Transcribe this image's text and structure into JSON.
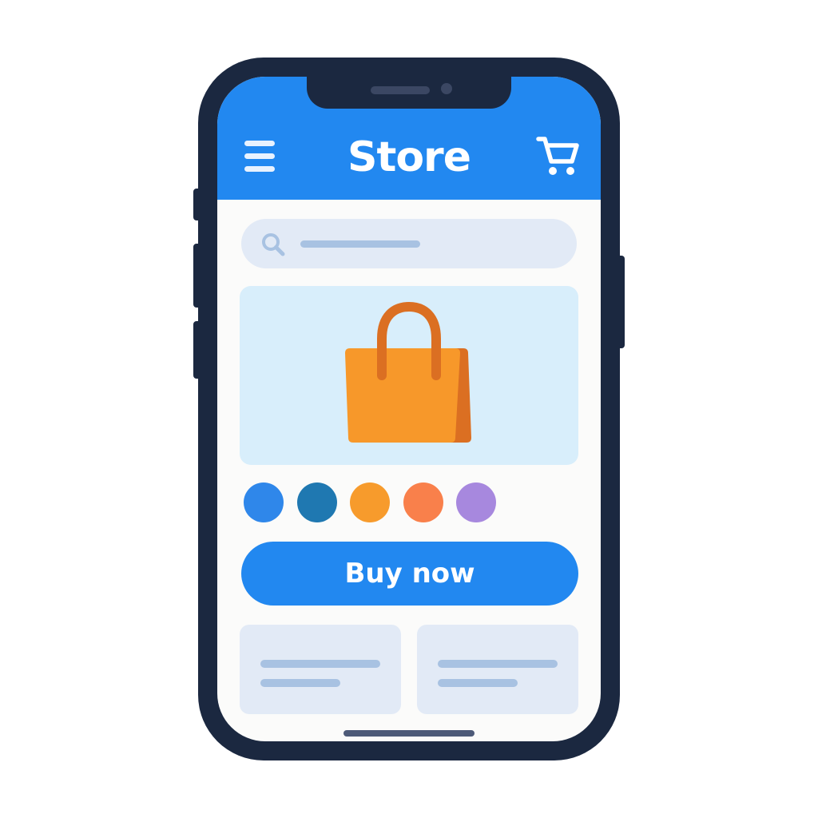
{
  "header": {
    "title": "Store",
    "background_color": "#2288f0",
    "menu_icon": "hamburger-menu-icon",
    "cart_icon": "shopping-cart-icon"
  },
  "search": {
    "icon": "search-icon",
    "placeholder_color": "#a8c2e2"
  },
  "product": {
    "image_icon": "shopping-bag-icon",
    "image_background": "#d8eefb",
    "bag_color": "#f7982a",
    "bag_handle_color": "#db6f22"
  },
  "color_options": [
    {
      "color": "#2f87ea"
    },
    {
      "color": "#1f78b1"
    },
    {
      "color": "#f79b2c"
    },
    {
      "color": "#f9804b"
    },
    {
      "color": "#a788de"
    }
  ],
  "buy_button": {
    "label": "Buy now",
    "color": "#2288f0"
  },
  "cards": [
    {
      "name": "product-card-left"
    },
    {
      "name": "product-card-right"
    }
  ],
  "phone": {
    "frame_color": "#1b2840",
    "screen_color": "#fbfbfa"
  }
}
